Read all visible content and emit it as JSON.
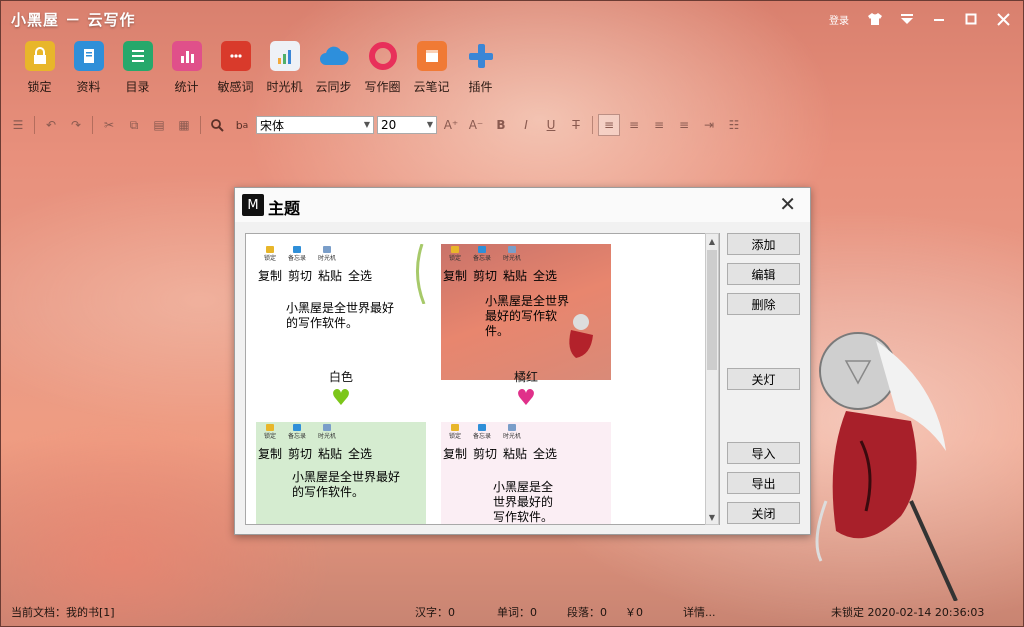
{
  "window": {
    "title": "小黑屋 － 云写作",
    "login_label": "登录",
    "controls": {
      "skin": "shirt-icon",
      "menu": "dropdown-icon",
      "minimize": "minimize-icon",
      "maximize": "maximize-icon",
      "close": "close-icon"
    }
  },
  "toolbar": {
    "items": [
      {
        "label": "锁定",
        "icon": "lock-icon",
        "color": "#e8b62a"
      },
      {
        "label": "资料",
        "icon": "book-icon",
        "color": "#2f8fd8"
      },
      {
        "label": "目录",
        "icon": "list-icon",
        "color": "#26a86b"
      },
      {
        "label": "统计",
        "icon": "chart-icon",
        "color": "#e0508a"
      },
      {
        "label": "敏感词",
        "icon": "chat-icon",
        "color": "#d93a2b"
      },
      {
        "label": "时光机",
        "icon": "timemachine-icon",
        "color": "#7a9ec9"
      },
      {
        "label": "云同步",
        "icon": "cloud-icon",
        "color": "#2d8fdc"
      },
      {
        "label": "写作圈",
        "icon": "circle-icon",
        "color": "#e8305a"
      },
      {
        "label": "云笔记",
        "icon": "note-icon",
        "color": "#f07a35"
      },
      {
        "label": "插件",
        "icon": "plus-icon",
        "color": "#3a86d6"
      }
    ]
  },
  "format": {
    "font": "宋体",
    "size": "20"
  },
  "dialog": {
    "title": "主题",
    "themes": [
      {
        "name": "白色",
        "bg": "#ffffff",
        "heart": "#7cc61a"
      },
      {
        "name": "橘红",
        "bg": "#e8866e",
        "heart": "#e0308a"
      },
      {
        "name": "",
        "bg": "#d5ecd0",
        "heart": ""
      },
      {
        "name": "",
        "bg": "#fbeef4",
        "heart": ""
      }
    ],
    "preview": {
      "icon_labels": [
        "锁定",
        "备忘录",
        "时光机"
      ],
      "menu": [
        "复制",
        "剪切",
        "粘贴",
        "全选"
      ],
      "sample_text": "小黑屋是全世界最好的写作软件。"
    },
    "buttons": {
      "add": "添加",
      "edit": "编辑",
      "delete": "删除",
      "lights_off": "关灯",
      "import": "导入",
      "export": "导出",
      "close": "关闭"
    }
  },
  "status": {
    "current_doc": "当前文档：我的书[1]",
    "hanzi": "汉字：0",
    "words": "单词：0",
    "paragraphs": "段落：0",
    "money": "￥0",
    "details": "详情...",
    "lock_status": "未锁定 2020-02-14 20:36:03"
  }
}
